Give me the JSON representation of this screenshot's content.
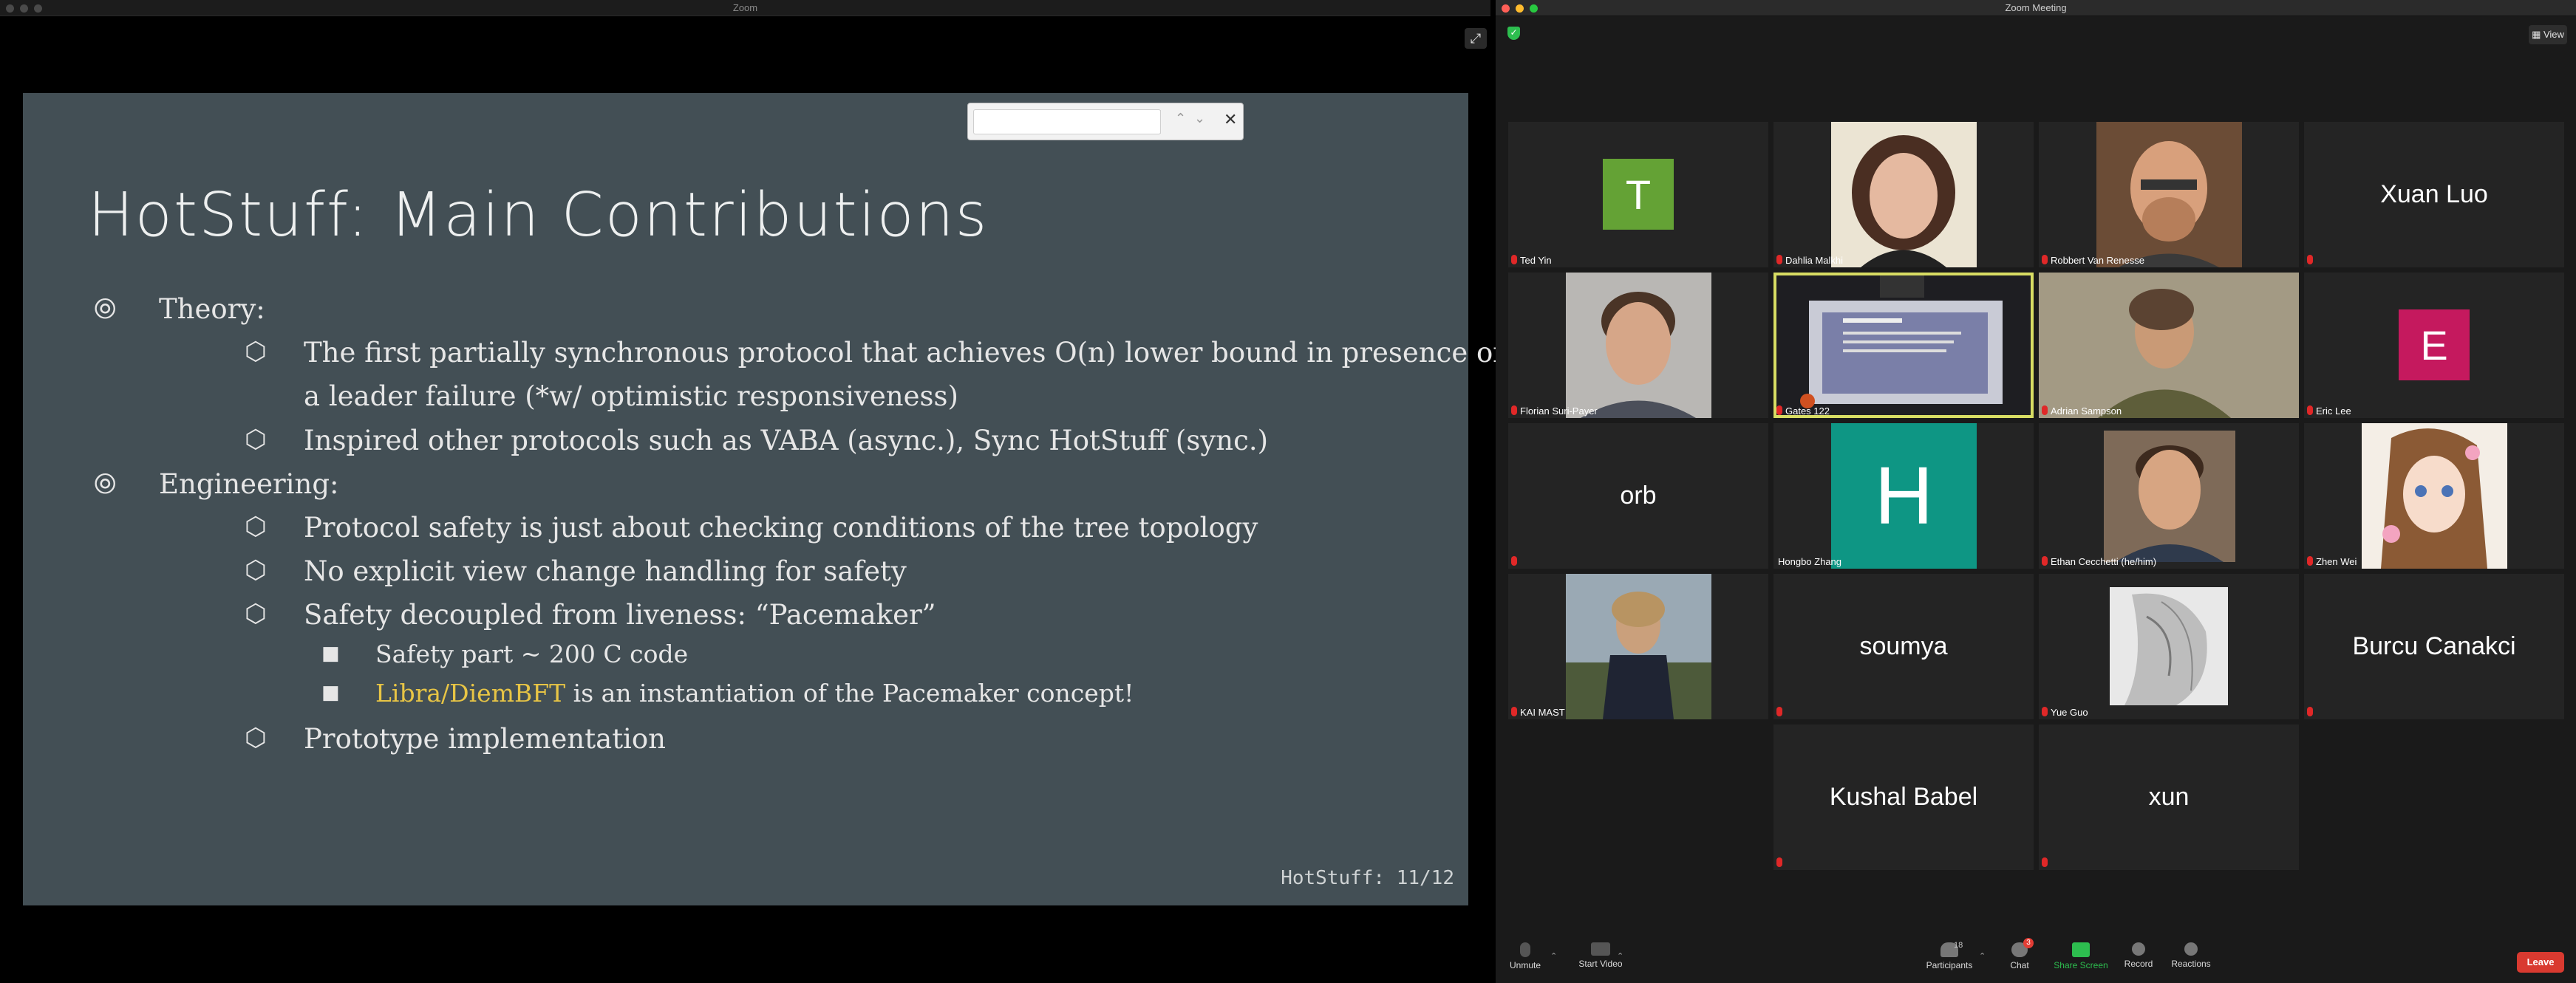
{
  "left_window": {
    "title": "Zoom",
    "slide": {
      "title": "HotStuff: Main Contributions",
      "items": {
        "theory": "Theory:",
        "theory_1a": "The first partially synchronous protocol that achieves O(n) lower bound in presence of",
        "theory_1b": "a leader failure (*w/ optimistic responsiveness)",
        "theory_2": "Inspired other protocols such as VABA (async.), Sync HotStuff (sync.)",
        "engineering": "Engineering:",
        "eng_1": "Protocol safety is just about checking conditions of the tree topology",
        "eng_2": "No explicit view change handling for safety",
        "eng_3": "Safety decoupled from liveness: “Pacemaker”",
        "eng_3a": "Safety part ~ 200 C code",
        "eng_3b_highlight": "Libra/DiemBFT",
        "eng_3b_rest": " is an instantiation of the Pacemaker concept!",
        "eng_4": "Prototype implementation"
      },
      "page_number": "HotStuff: 11/12",
      "accent_color": "#e8c545"
    },
    "find_bar": {
      "up_icon": "⌃",
      "down_icon": "⌄",
      "close_icon": "✕"
    }
  },
  "right_window": {
    "title": "Zoom Meeting",
    "view_label": "View",
    "participants": [
      {
        "name": "Ted Yin",
        "display": "T",
        "kind": "letter",
        "color": "#64a235"
      },
      {
        "name": "Dahlia Malkhi",
        "kind": "photo"
      },
      {
        "name": "Robbert Van Renesse",
        "kind": "photo"
      },
      {
        "name": "Xuan Luo",
        "kind": "name"
      },
      {
        "name": "Florian Suri-Payer",
        "kind": "photo"
      },
      {
        "name": "Gates 122",
        "kind": "video",
        "speaking": true
      },
      {
        "name": "Adrian Sampson",
        "kind": "video"
      },
      {
        "name": "Eric Lee",
        "display": "E",
        "kind": "letter",
        "color": "#c5195e"
      },
      {
        "name": "orb",
        "kind": "name"
      },
      {
        "name": "Hongbo Zhang",
        "display": "H",
        "kind": "letter",
        "color": "#0e9684"
      },
      {
        "name": "Ethan Cecchetti (he/him)",
        "kind": "photo"
      },
      {
        "name": "Zhen Wei",
        "kind": "photo"
      },
      {
        "name": "KAI MAST",
        "kind": "photo"
      },
      {
        "name": "soumya",
        "kind": "name"
      },
      {
        "name": "Yue Guo",
        "kind": "photo"
      },
      {
        "name": "Burcu Canakci",
        "kind": "name"
      },
      {
        "name": "Kushal Babel",
        "kind": "name"
      },
      {
        "name": "xun",
        "kind": "name"
      }
    ],
    "toolbar": {
      "unmute": "Unmute",
      "start_video": "Start Video",
      "participants": "Participants",
      "participants_count": "18",
      "chat": "Chat",
      "chat_badge": "3",
      "share_screen": "Share Screen",
      "record": "Record",
      "reactions": "Reactions",
      "leave": "Leave"
    },
    "share_color": "#2dbe4f"
  }
}
